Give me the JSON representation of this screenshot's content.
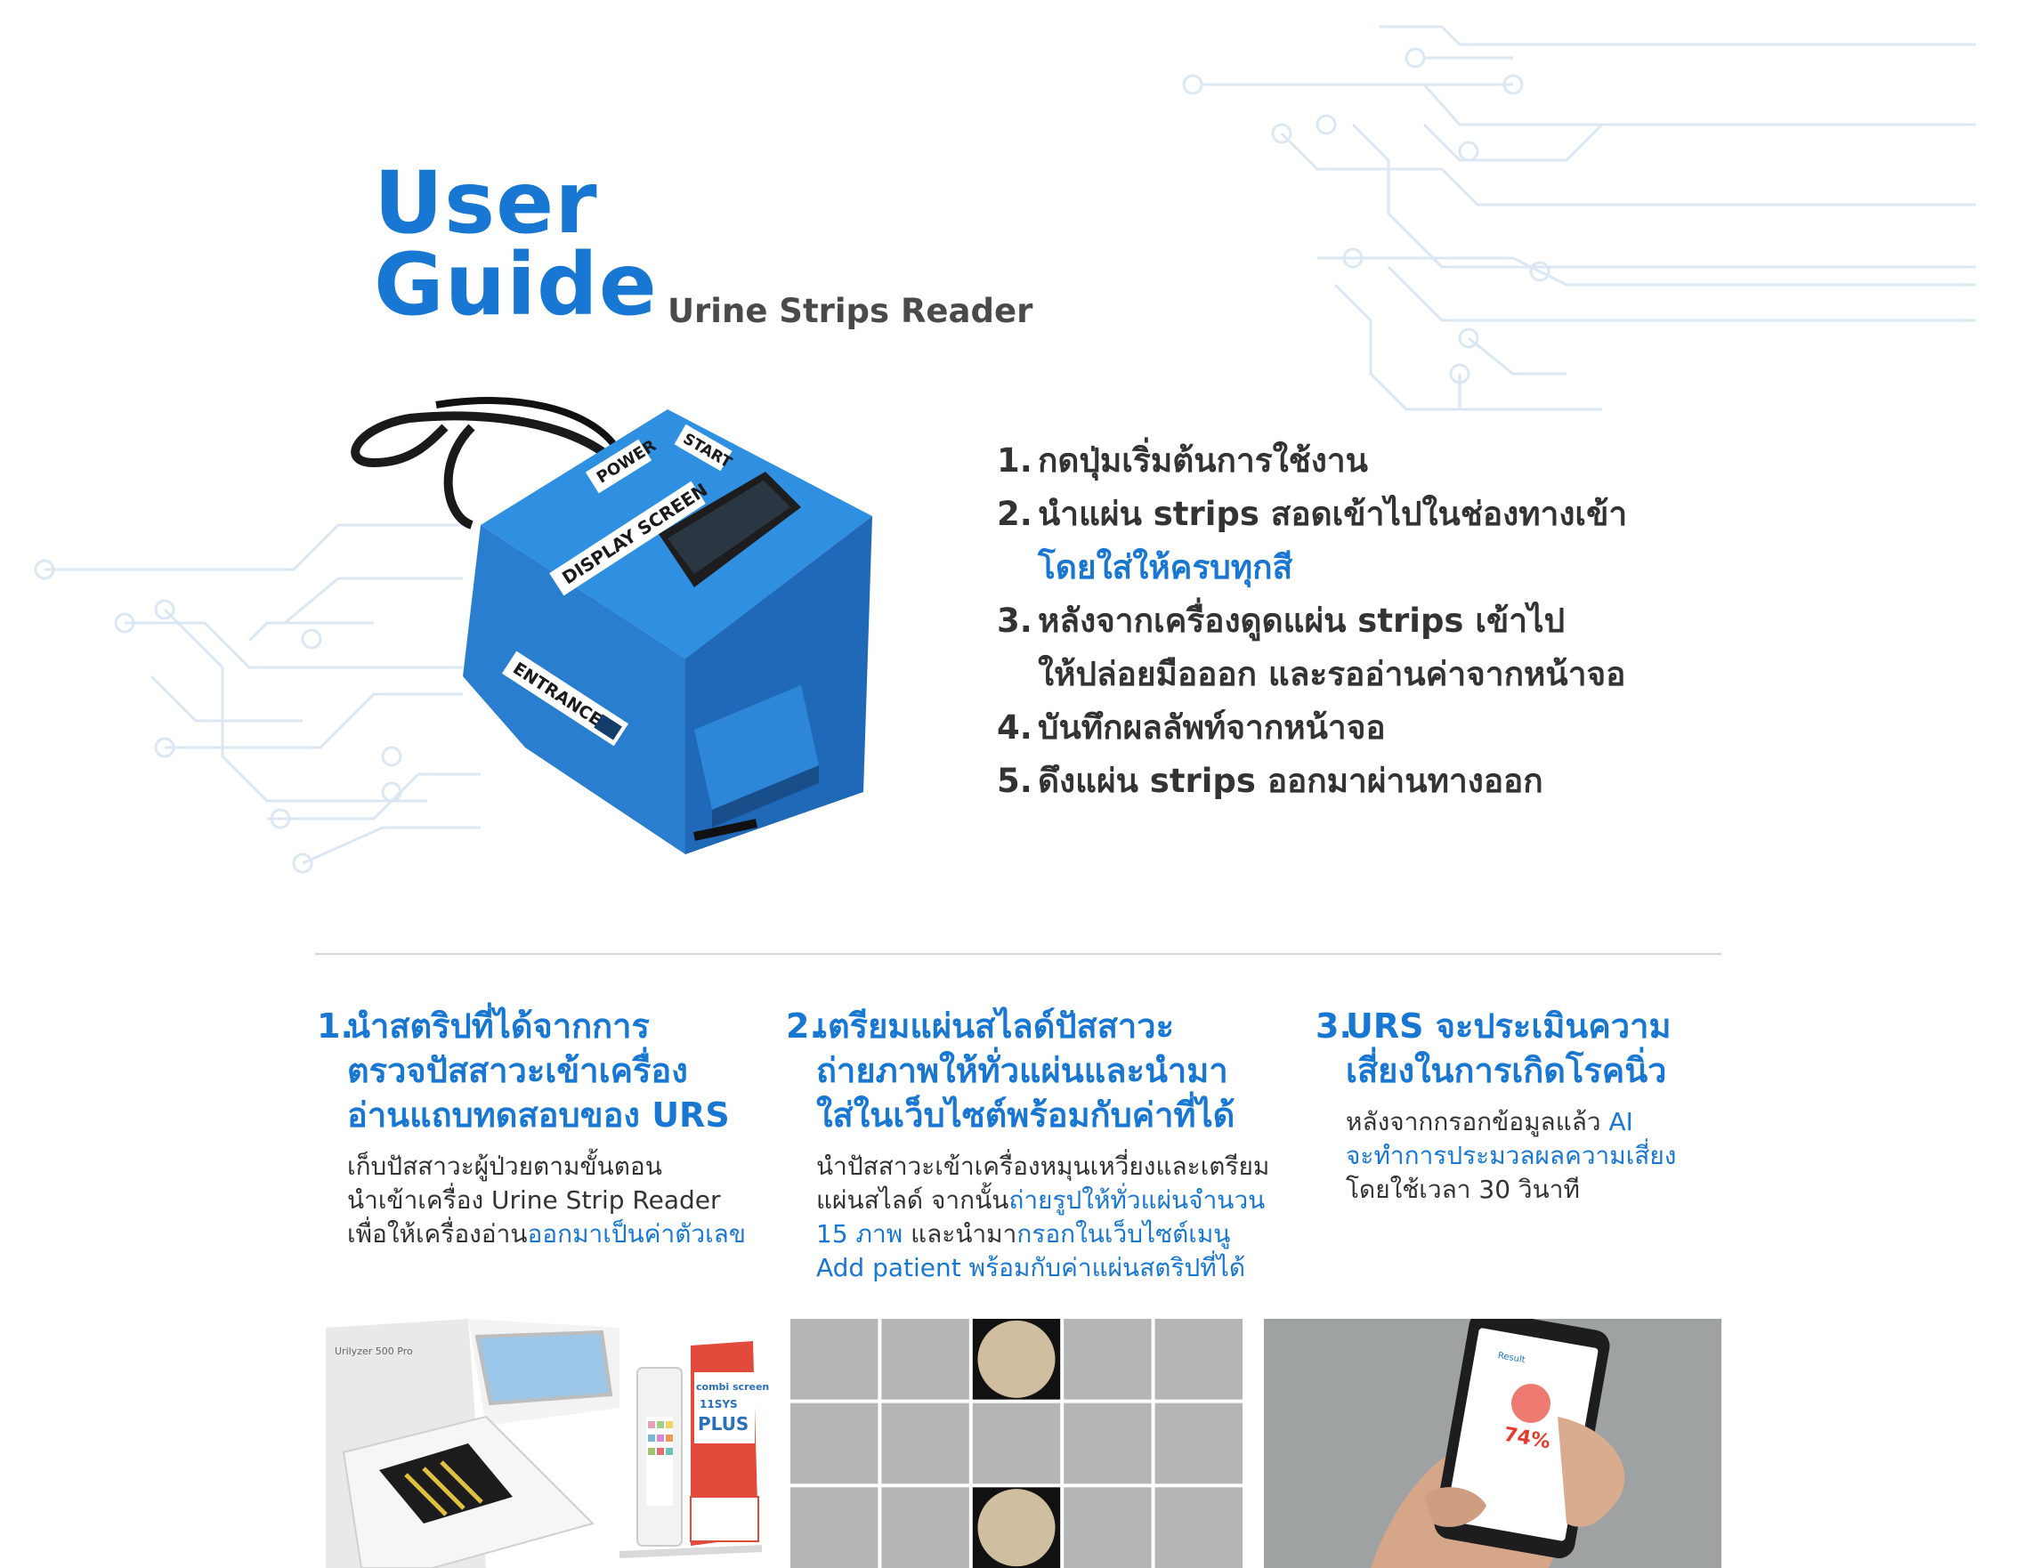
{
  "header": {
    "title_line1": "User",
    "title_line2": "Guide",
    "subtitle": "Urine Strips Reader"
  },
  "device": {
    "labels": {
      "power": "POWER",
      "start": "START",
      "display": "DISPLAY SCREEN",
      "entrance": "ENTRANCE"
    }
  },
  "steps": [
    {
      "num": "1.",
      "text": "กดปุ่มเริ่มต้นการใช้งาน"
    },
    {
      "num": "2.",
      "text": "นำแผ่น strips สอดเข้าไปในช่องทางเข้า",
      "cont_blue": "โดยใส่ให้ครบทุกสี"
    },
    {
      "num": "3.",
      "text": "หลังจากเครื่องดูดแผ่น strips เข้าไป",
      "cont": "ให้ปล่อยมือออก และรออ่านค่าจากหน้าจอ"
    },
    {
      "num": "4.",
      "text": "บันทึกผลลัพท์จากหน้าจอ"
    },
    {
      "num": "5.",
      "text": "ดึงแผ่น strips ออกมาผ่านทางออก"
    }
  ],
  "columns": [
    {
      "num": "1.",
      "head": [
        "นำสตริปที่ได้จากการ",
        "ตรวจปัสสาวะเข้าเครื่อง",
        "อ่านแถบทดสอบของ URS"
      ],
      "body1": "เก็บปัสสาวะผู้ป่วยตามขั้นตอน",
      "body2": "นำเข้าเครื่อง Urine Strip Reader",
      "body3": "เพื่อให้เครื่องอ่าน",
      "body3_blue": "ออกมาเป็นค่าตัวเลข"
    },
    {
      "num": "2.",
      "head": [
        "เตรียมแผ่นสไลด์ปัสสาวะ",
        "ถ่ายภาพให้ทั่วแผ่นและนำมา",
        "ใส่ในเว็บไซต์พร้อมกับค่าที่ได้"
      ],
      "body1": "นำปัสสาวะเข้าเครื่องหมุนเหวี่ยงและเตรียม",
      "body2": "แผ่นสไลด์ จากนั้น",
      "body2_blue": "ถ่ายรูปให้ทั่วแผ่นจำนวน",
      "body3_blue": "15 ภาพ",
      "body3": " และนำมา",
      "body3_blue2": "กรอกในเว็บไซต์เมนู",
      "body4_blue": "Add patient พร้อมกับค่าแผ่นสตริปที่ได้"
    },
    {
      "num": "3.",
      "head": [
        "URS จะประเมินความ",
        "เสี่ยงในการเกิดโรคนิ่ว"
      ],
      "body1": "หลังจากกรอกข้อมูลแล้ว ",
      "body1_blue": "AI",
      "body2_blue": "จะทำการประมวลผลความเสี่ยง",
      "body3": "โดยใช้เวลา 30 วินาที"
    }
  ],
  "photos": {
    "analyzer_label": "Urilyzer 500 Pro",
    "box_brand": "combi screen",
    "box_variant": "11SYS",
    "box_plus": "PLUS",
    "phone_header": "Result",
    "phone_percent": "74%"
  },
  "colors": {
    "accent": "#1877d2",
    "text": "#333333",
    "circuit": "#dbe7f2"
  }
}
